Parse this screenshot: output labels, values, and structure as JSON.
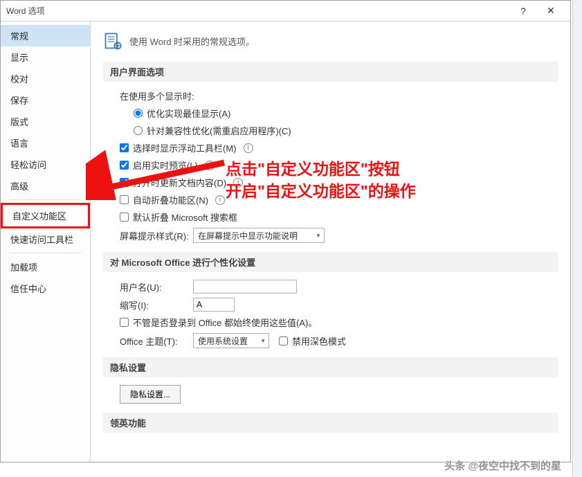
{
  "titlebar": {
    "title": "Word 选项"
  },
  "sidebar": {
    "items": [
      {
        "label": "常规"
      },
      {
        "label": "显示"
      },
      {
        "label": "校对"
      },
      {
        "label": "保存"
      },
      {
        "label": "版式"
      },
      {
        "label": "语言"
      },
      {
        "label": "轻松访问"
      },
      {
        "label": "高级"
      },
      {
        "label": "自定义功能区"
      },
      {
        "label": "快速访问工具栏"
      },
      {
        "label": "加载项"
      },
      {
        "label": "信任中心"
      }
    ]
  },
  "heading": "使用 Word 时采用的常规选项。",
  "sections": {
    "ui": {
      "title": "用户界面选项",
      "multi_display_label": "在使用多个显示时:",
      "opt_optimize": "优化实现最佳显示(A)",
      "opt_compat": "针对兼容性优化(需重启应用程序)(C)",
      "cb_mini_toolbar": "选择时显示浮动工具栏(M)",
      "cb_live_preview": "启用实时预览(L)",
      "cb_update_doc": "打开时更新文档内容(D)",
      "cb_auto_collapse": "自动折叠功能区(N)",
      "cb_collapse_search": "默认折叠 Microsoft 搜索框",
      "screentip_label": "屏幕提示样式(R):",
      "screentip_value": "在屏幕提示中显示功能说明"
    },
    "personalize": {
      "title": "对 Microsoft Office 进行个性化设置",
      "username_label": "用户名(U):",
      "username_value": "",
      "initials_label": "缩写(I):",
      "initials_value": "A",
      "always_use": "不管是否登录到 Office 都始终使用这些值(A)。",
      "theme_label": "Office 主题(T):",
      "theme_value": "使用系统设置",
      "disable_dark": "禁用深色模式"
    },
    "privacy": {
      "title": "隐私设置",
      "button": "隐私设置..."
    },
    "linkedin": {
      "title": "领英功能"
    }
  },
  "annotation": {
    "line1": "点击\"自定义功能区\"按钮",
    "line2": "开启\"自定义功能区\"的操作"
  },
  "watermark": "头条 @夜空中找不到的星"
}
